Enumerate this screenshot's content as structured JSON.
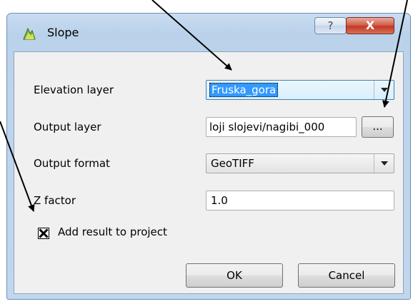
{
  "window": {
    "title": "Slope",
    "help_glyph": "?",
    "close_glyph": "X"
  },
  "form": {
    "elevation_label": "Elevation layer",
    "elevation_value": "Fruska_gora",
    "output_layer_label": "Output layer",
    "output_layer_value": "loji slojevi/nagibi_000",
    "browse_label": "...",
    "output_format_label": "Output format",
    "output_format_value": "GeoTIFF",
    "z_factor_label": "Z factor",
    "z_factor_value": "1.0",
    "add_result_label": "Add result to project",
    "add_result_checked": true
  },
  "buttons": {
    "ok": "OK",
    "cancel": "Cancel"
  },
  "icons": {
    "title_icon": "slope-plugin-icon",
    "checkbox_mark": "x-mark-icon"
  }
}
